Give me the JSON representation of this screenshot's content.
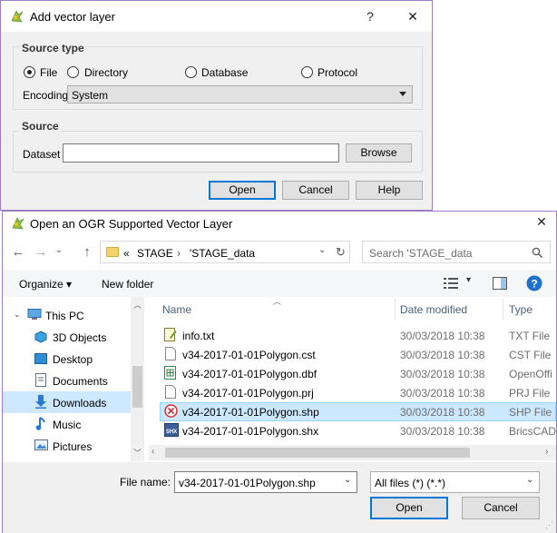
{
  "add_vector_layer": {
    "title": "Add vector layer",
    "help_glyph": "?",
    "close_glyph": "✕",
    "source_type": {
      "title": "Source type",
      "options": [
        "File",
        "Directory",
        "Database",
        "Protocol"
      ],
      "selected": "File",
      "encoding_label": "Encoding",
      "encoding_value": "System"
    },
    "source": {
      "title": "Source",
      "dataset_label": "Dataset",
      "dataset_value": "",
      "browse_label": "Browse"
    },
    "buttons": {
      "open": "Open",
      "cancel": "Cancel",
      "help": "Help"
    }
  },
  "open_dialog": {
    "title": "Open an OGR Supported Vector Layer",
    "close_glyph": "✕",
    "breadcrumb": {
      "prefix": "«",
      "items": [
        "STAGE",
        "'STAGE_data"
      ]
    },
    "search_placeholder": "Search 'STAGE_data",
    "toolbar": {
      "organize": "Organize ▾",
      "new_folder": "New folder"
    },
    "nav_items": [
      {
        "label": "This PC",
        "icon": "pc-icon"
      },
      {
        "label": "3D Objects",
        "icon": "cube-icon"
      },
      {
        "label": "Desktop",
        "icon": "desktop-icon"
      },
      {
        "label": "Documents",
        "icon": "documents-icon"
      },
      {
        "label": "Downloads",
        "icon": "download-icon"
      },
      {
        "label": "Music",
        "icon": "music-icon"
      },
      {
        "label": "Pictures",
        "icon": "pictures-icon"
      }
    ],
    "selected_nav": "Downloads",
    "columns": {
      "name": "Name",
      "date": "Date modified",
      "type": "Type"
    },
    "files": [
      {
        "name": "info.txt",
        "date": "30/03/2018 10:38",
        "type": "TXT File"
      },
      {
        "name": "v34-2017-01-01Polygon.cst",
        "date": "30/03/2018 10:38",
        "type": "CST File"
      },
      {
        "name": "v34-2017-01-01Polygon.dbf",
        "date": "30/03/2018 10:38",
        "type": "OpenOffi"
      },
      {
        "name": "v34-2017-01-01Polygon.prj",
        "date": "30/03/2018 10:38",
        "type": "PRJ File"
      },
      {
        "name": "v34-2017-01-01Polygon.shp",
        "date": "30/03/2018 10:38",
        "type": "SHP File"
      },
      {
        "name": "v34-2017-01-01Polygon.shx",
        "date": "30/03/2018 10:38",
        "type": "BricsCAD"
      }
    ],
    "selected_file": "v34-2017-01-01Polygon.shp",
    "file_name_label": "File name:",
    "file_name_value": "v34-2017-01-01Polygon.shp",
    "filter_value": "All files (*) (*.*)",
    "buttons": {
      "open": "Open",
      "cancel": "Cancel"
    }
  },
  "colors": {
    "accent": "#0078d7",
    "selection": "#cce8ff",
    "frame": "#9b7fc2"
  }
}
